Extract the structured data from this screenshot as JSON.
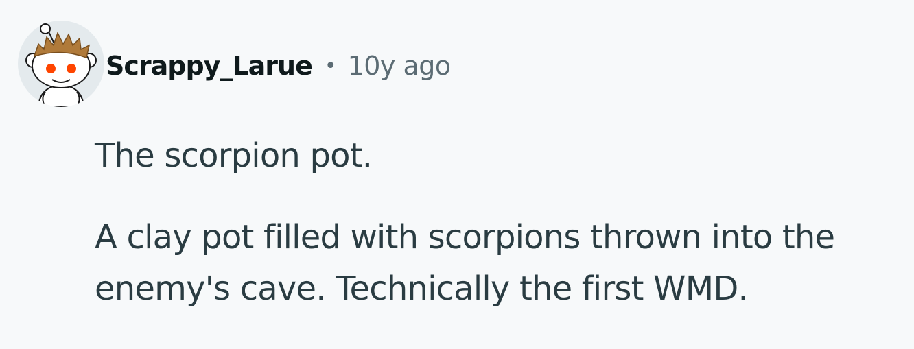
{
  "comment": {
    "author": {
      "username": "Scrappy_Larue",
      "avatar_icon": "snoo-avatar-icon"
    },
    "separator": "•",
    "timestamp": "10y ago",
    "paragraphs": [
      "The scorpion pot.",
      "A clay pot filled with scorpions thrown into the\nenemy's cave. Technically the first WMD."
    ]
  },
  "colors": {
    "background": "#f7f9fa",
    "username": "#0f1a1c",
    "meta_text": "#5c6c74",
    "body_text": "#2a3c42",
    "avatar_bg": "#e4eaed",
    "hair": "#b07a3a",
    "eyes": "#ff4500"
  }
}
